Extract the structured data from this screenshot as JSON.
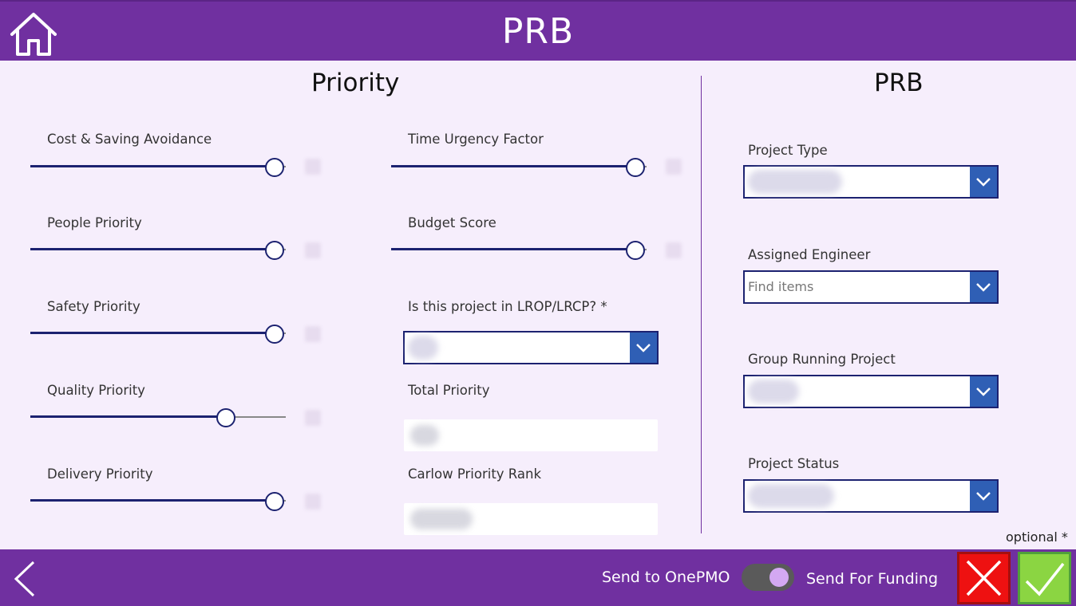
{
  "header": {
    "title": "PRB",
    "home_icon": "home-icon"
  },
  "priority": {
    "title": "Priority",
    "sliders": [
      {
        "label": "Cost & Saving Avoidance",
        "value_fraction": 1.0
      },
      {
        "label": "People Priority",
        "value_fraction": 1.0
      },
      {
        "label": "Safety Priority",
        "value_fraction": 1.0
      },
      {
        "label": "Quality Priority",
        "value_fraction": 0.79
      },
      {
        "label": "Delivery Priority",
        "value_fraction": 1.0
      },
      {
        "label": "Time Urgency Factor",
        "value_fraction": 1.0
      },
      {
        "label": "Budget Score",
        "value_fraction": 1.0
      }
    ],
    "lrop_label": "Is this project in LROP/LRCP? *",
    "total_label": "Total Priority",
    "rank_label": "Carlow Priority Rank"
  },
  "prb": {
    "title": "PRB",
    "project_type_label": "Project Type",
    "assigned_engineer_label": "Assigned Engineer",
    "assigned_engineer_placeholder": "Find items",
    "group_label": "Group Running Project",
    "status_label": "Project Status"
  },
  "footer": {
    "optional_note": "optional *",
    "send_onepmo_label": "Send to OnePMO",
    "send_funding_label": "Send For Funding",
    "toggle_on": true,
    "back_icon": "chevron-left-icon",
    "cancel_icon": "close-icon",
    "confirm_icon": "checkmark-icon"
  },
  "colors": {
    "brand": "#7030a0",
    "background": "#f6eefc",
    "slider": "#1c2270",
    "dropdown_button": "#2f5fb5",
    "cancel": "#ee1111",
    "confirm": "#8bd542"
  }
}
